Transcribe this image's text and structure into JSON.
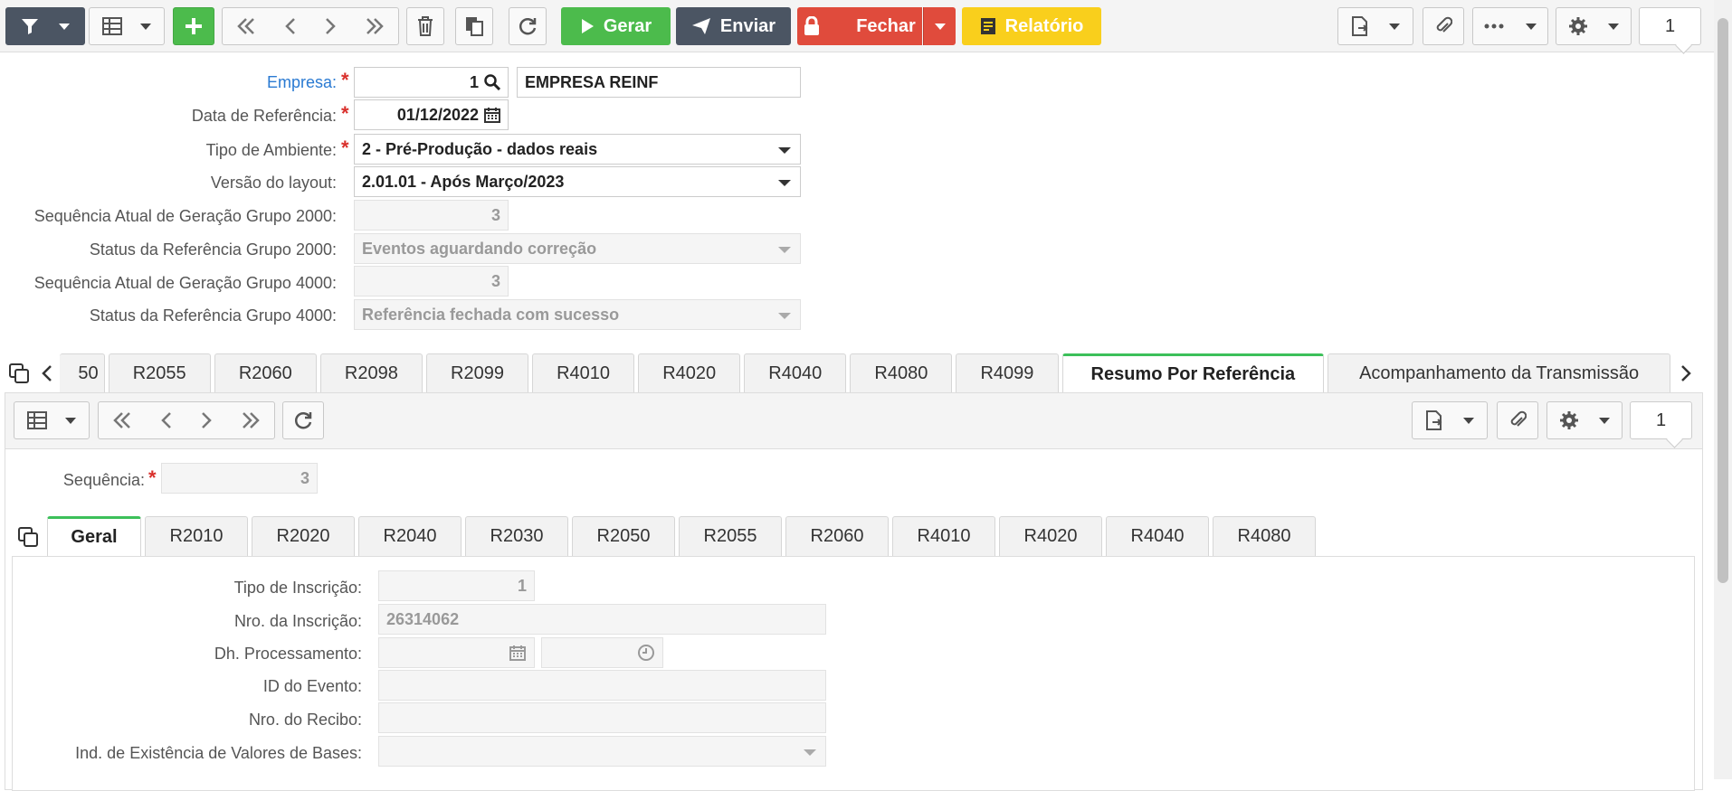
{
  "toolbar": {
    "gerar_label": "Gerar",
    "enviar_label": "Enviar",
    "fechar_label": "Fechar",
    "relatorio_label": "Relatório",
    "page": "1",
    "colors": {
      "green": "#4cbb4c",
      "dark": "#4b5563",
      "red": "#e04b3c",
      "yellow": "#f9cf1c"
    }
  },
  "form": {
    "empresa": {
      "label": "Empresa:",
      "code": "1",
      "name": "EMPRESA REINF"
    },
    "data_ref": {
      "label": "Data de Referência:",
      "value": "01/12/2022"
    },
    "tipo_ambiente": {
      "label": "Tipo de Ambiente:",
      "value": "2 - Pré-Produção - dados reais"
    },
    "versao_layout": {
      "label": "Versão do layout:",
      "value": "2.01.01 - Após Março/2023"
    },
    "seq_2000": {
      "label": "Sequência Atual de Geração Grupo 2000:",
      "value": "3"
    },
    "status_2000": {
      "label": "Status da Referência Grupo 2000:",
      "value": "Eventos aguardando correção"
    },
    "seq_4000": {
      "label": "Sequência Atual de Geração Grupo 4000:",
      "value": "3"
    },
    "status_4000": {
      "label": "Status da Referência Grupo 4000:",
      "value": "Referência fechada com sucesso"
    }
  },
  "main_tabs": [
    "50",
    "R2055",
    "R2060",
    "R2098",
    "R2099",
    "R4010",
    "R4020",
    "R4040",
    "R4080",
    "R4099",
    "Resumo Por Referência",
    "Acompanhamento da Transmissão"
  ],
  "sub_toolbar": {
    "page": "1"
  },
  "detail": {
    "sequencia": {
      "label": "Sequência:",
      "value": "3"
    }
  },
  "inner_tabs": [
    "Geral",
    "R2010",
    "R2020",
    "R2040",
    "R2030",
    "R2050",
    "R2055",
    "R2060",
    "R4010",
    "R4020",
    "R4040",
    "R4080"
  ],
  "geral": {
    "tipo_inscricao": {
      "label": "Tipo de Inscrição:",
      "value": "1"
    },
    "nro_inscricao": {
      "label": "Nro. da Inscrição:",
      "value": "26314062"
    },
    "dh_processamento": {
      "label": "Dh. Processamento:"
    },
    "id_evento": {
      "label": "ID do Evento:"
    },
    "nro_recibo": {
      "label": "Nro. do Recibo:"
    },
    "ind_existencia": {
      "label": "Ind. de Existência de Valores de Bases:"
    }
  }
}
